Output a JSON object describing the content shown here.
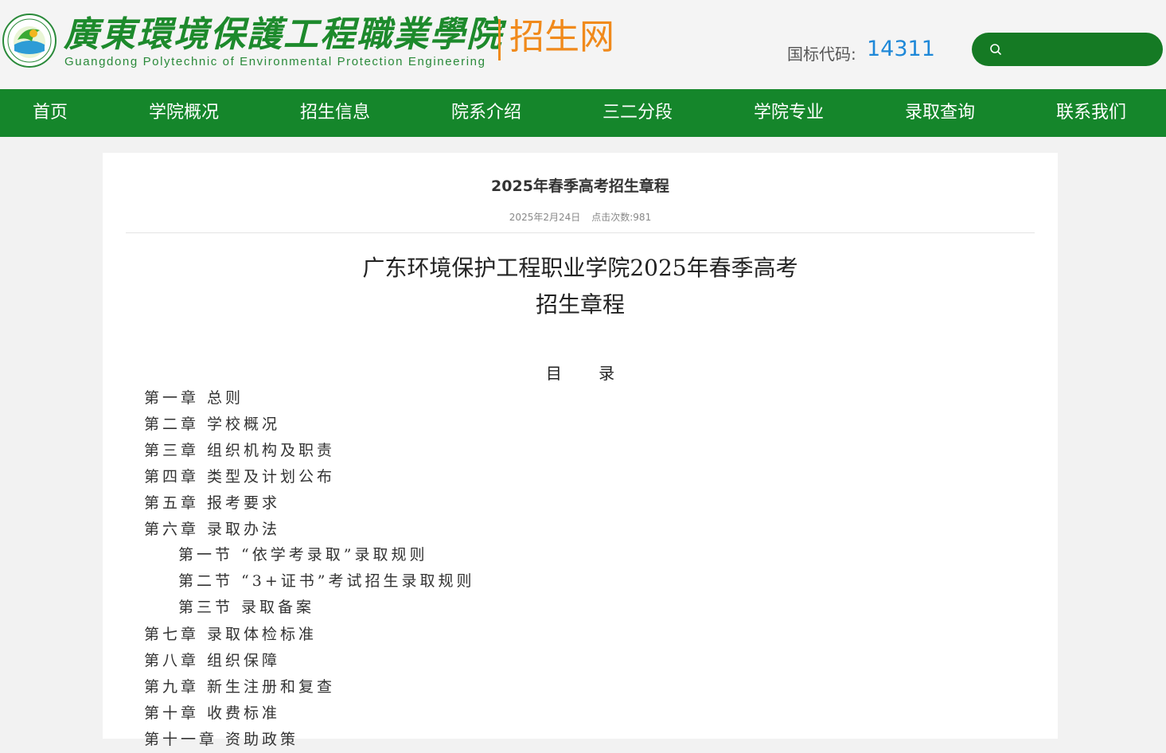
{
  "header": {
    "logo_cn": "廣東環境保護工程職業學院",
    "logo_en": "Guangdong Polytechnic of Environmental Protection Engineering",
    "logo_sub": "招生网",
    "code_label": "国标代码:",
    "code_value": "14311",
    "search": {
      "placeholder": "",
      "value": ""
    }
  },
  "nav": {
    "items": [
      "首页",
      "学院概况",
      "招生信息",
      "院系介绍",
      "三二分段",
      "学院专业",
      "录取查询",
      "联系我们"
    ]
  },
  "article": {
    "title": "2025年春季高考招生章程",
    "date": "2025年2月24日",
    "views": "点击次数:981",
    "doc_title_line1": "广东环境保护工程职业学院2025年春季高考",
    "doc_title_line2": "招生章程",
    "toc_heading": "目 录",
    "toc": [
      "第一章 总则",
      "第二章 学校概况",
      "第三章 组织机构及职责",
      "第四章 类型及计划公布",
      "第五章 报考要求",
      "第六章 录取办法",
      "第一节 “依学考录取”录取规则",
      "第二节 “3+证书”考试招生录取规则",
      "第三节 录取备案",
      "第七章 录取体检标准",
      "第八章 组织保障",
      "第九章 新生注册和复查",
      "第十章 收费标准",
      "第十一章 资助政策"
    ]
  },
  "colors": {
    "brand_green": "#15862b",
    "accent_orange": "#f08a1c",
    "code_blue": "#1e88d8"
  }
}
